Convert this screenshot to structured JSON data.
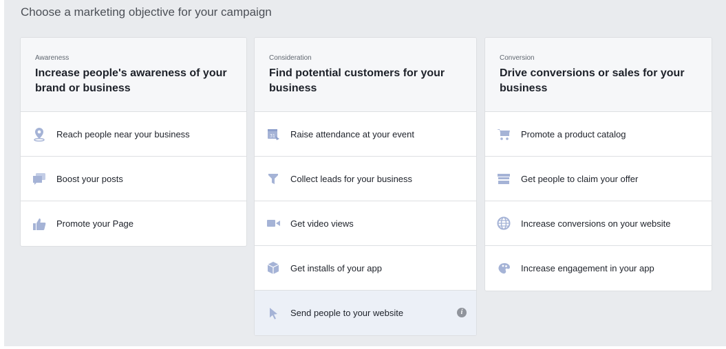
{
  "page": {
    "heading": "Choose a marketing objective for your campaign"
  },
  "colors": {
    "icon": "#a5b3d6",
    "selected_bg": "#ecf0f7",
    "panel_bg": "#e9ebee"
  },
  "columns": [
    {
      "category": "Awareness",
      "title": "Increase people's awareness of your brand or business",
      "items": [
        {
          "label": "Reach people near your business",
          "icon": "map-pin-icon"
        },
        {
          "label": "Boost your posts",
          "icon": "chat-bubbles-icon"
        },
        {
          "label": "Promote your Page",
          "icon": "thumbs-up-icon"
        }
      ]
    },
    {
      "category": "Consideration",
      "title": "Find potential customers for your business",
      "items": [
        {
          "label": "Raise attendance at your event",
          "icon": "calendar-icon"
        },
        {
          "label": "Collect leads for your business",
          "icon": "funnel-icon"
        },
        {
          "label": "Get video views",
          "icon": "video-camera-icon"
        },
        {
          "label": "Get installs of your app",
          "icon": "app-box-icon"
        },
        {
          "label": "Send people to your website",
          "icon": "cursor-icon",
          "selected": true,
          "info": "i"
        }
      ]
    },
    {
      "category": "Conversion",
      "title": "Drive conversions or sales for your business",
      "items": [
        {
          "label": "Promote a product catalog",
          "icon": "shopping-cart-icon"
        },
        {
          "label": "Get people to claim your offer",
          "icon": "storefront-icon"
        },
        {
          "label": "Increase conversions on your website",
          "icon": "globe-icon"
        },
        {
          "label": "Increase engagement in your app",
          "icon": "palette-icon"
        }
      ]
    }
  ]
}
